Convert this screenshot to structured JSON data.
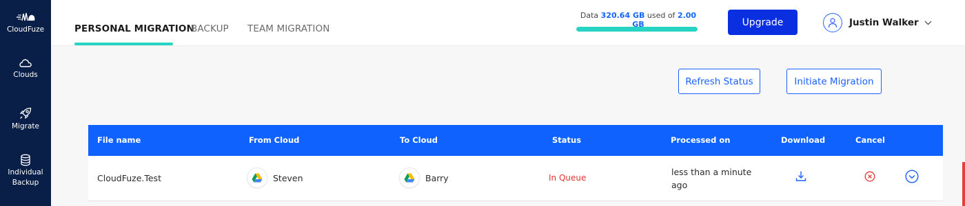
{
  "sidebar": {
    "brand": "CloudFuze",
    "items": [
      {
        "label": "Clouds",
        "icon": "cloud-icon"
      },
      {
        "label": "Migrate",
        "icon": "rocket-icon"
      },
      {
        "label_line1": "Individual",
        "label_line2": "Backup",
        "icon": "database-icon"
      }
    ]
  },
  "tabs": [
    "PERSONAL MIGRATION",
    "BACKUP",
    "TEAM MIGRATION"
  ],
  "storage": {
    "prefix": "Data",
    "used": "320.64 GB",
    "middle": "used of",
    "total": "2.00 GB",
    "fill_fraction": 1.0
  },
  "upgrade_label": "Upgrade",
  "user": {
    "name": "Justin Walker"
  },
  "actions": {
    "refresh": "Refresh Status",
    "initiate": "Initiate Migration"
  },
  "table": {
    "headers": [
      "File name",
      "From Cloud",
      "To Cloud",
      "Status",
      "Processed on",
      "Download",
      "Cancel"
    ],
    "rows": [
      {
        "file_name": "CloudFuze.Test",
        "from_cloud": "Steven",
        "to_cloud": "Barry",
        "status": "In Queue",
        "processed_line1": "less than a minute",
        "processed_line2": "ago"
      }
    ]
  },
  "colors": {
    "sidebar_bg": "#0a1f47",
    "accent_teal": "#27d3c3",
    "primary_blue": "#0f62fe",
    "status_red": "#e23434"
  }
}
